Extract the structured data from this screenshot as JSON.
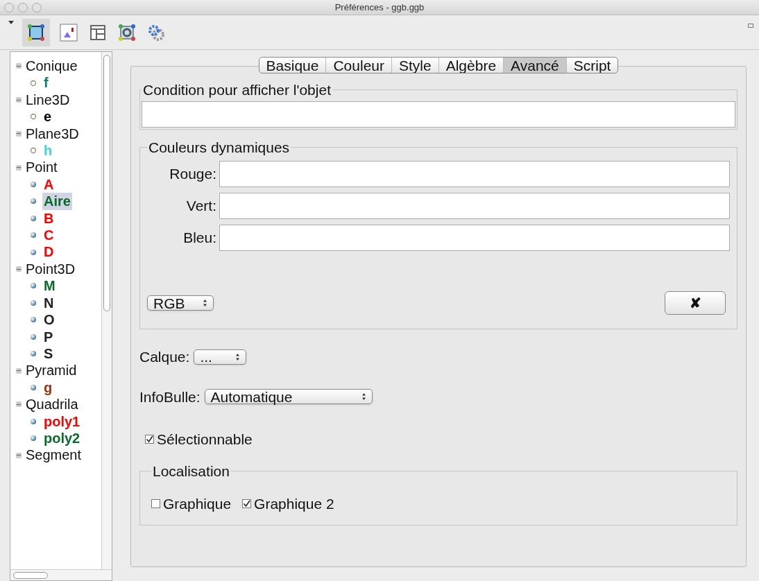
{
  "window": {
    "title": "Préférences - ggb.ggb"
  },
  "tree": [
    {
      "label": "Conique",
      "expanded": true,
      "children": [
        {
          "label": "f",
          "kind": "hollow",
          "color": "#117a7a",
          "selected": false
        }
      ]
    },
    {
      "label": "Line3D",
      "expanded": true,
      "children": [
        {
          "label": "e",
          "kind": "hollow",
          "color": "#000000",
          "selected": false
        }
      ]
    },
    {
      "label": "Plane3D",
      "expanded": true,
      "children": [
        {
          "label": "h",
          "kind": "hollow",
          "color": "#3fd4d8",
          "selected": false
        }
      ]
    },
    {
      "label": "Point",
      "expanded": true,
      "children": [
        {
          "label": "A",
          "kind": "ball",
          "color": "#ff0000",
          "selected": false
        },
        {
          "label": "Aire",
          "kind": "ball",
          "color": "#0a6a2a",
          "selected": true
        },
        {
          "label": "B",
          "kind": "ball",
          "color": "#ff0000",
          "selected": false
        },
        {
          "label": "C",
          "kind": "ball",
          "color": "#ff0000",
          "selected": false
        },
        {
          "label": "D",
          "kind": "ball",
          "color": "#ff0000",
          "selected": false
        }
      ]
    },
    {
      "label": "Point3D",
      "expanded": true,
      "children": [
        {
          "label": "M",
          "kind": "ball",
          "color": "#0a6a2a",
          "selected": false
        },
        {
          "label": "N",
          "kind": "ball",
          "color": "#222222",
          "selected": false
        },
        {
          "label": "O",
          "kind": "ball",
          "color": "#222222",
          "selected": false
        },
        {
          "label": "P",
          "kind": "ball",
          "color": "#222222",
          "selected": false
        },
        {
          "label": "S",
          "kind": "ball",
          "color": "#222222",
          "selected": false
        }
      ]
    },
    {
      "label": "Pyramid",
      "expanded": true,
      "children": [
        {
          "label": "g",
          "kind": "ball",
          "color": "#993311",
          "selected": false
        }
      ]
    },
    {
      "label": "Quadrila",
      "expanded": true,
      "children": [
        {
          "label": "poly1",
          "kind": "ball",
          "color": "#ff0000",
          "selected": false
        },
        {
          "label": "poly2",
          "kind": "ball",
          "color": "#0a6a2a",
          "selected": false
        }
      ]
    },
    {
      "label": "Segment",
      "expanded": true
    }
  ],
  "tabs": [
    {
      "label": "Basique",
      "selected": false
    },
    {
      "label": "Couleur",
      "selected": false
    },
    {
      "label": "Style",
      "selected": false
    },
    {
      "label": "Algèbre",
      "selected": false
    },
    {
      "label": "Avancé",
      "selected": true
    },
    {
      "label": "Script",
      "selected": false
    }
  ],
  "condition": {
    "legend": "Condition pour afficher l'objet"
  },
  "dynamic_colors": {
    "legend": "Couleurs dynamiques",
    "fields": [
      {
        "label": "Rouge:"
      },
      {
        "label": "Vert:"
      },
      {
        "label": "Bleu:"
      }
    ],
    "mode": "RGB",
    "clear_button": "✘"
  },
  "layer": {
    "label": "Calque:",
    "value": "..."
  },
  "tooltip": {
    "label": "InfoBulle:",
    "value": "Automatique"
  },
  "selectable": {
    "label": "Sélectionnable",
    "checked": true
  },
  "location": {
    "legend": "Localisation",
    "options": [
      {
        "label": "Graphique",
        "checked": false
      },
      {
        "label": "Graphique 2",
        "checked": true
      }
    ]
  }
}
